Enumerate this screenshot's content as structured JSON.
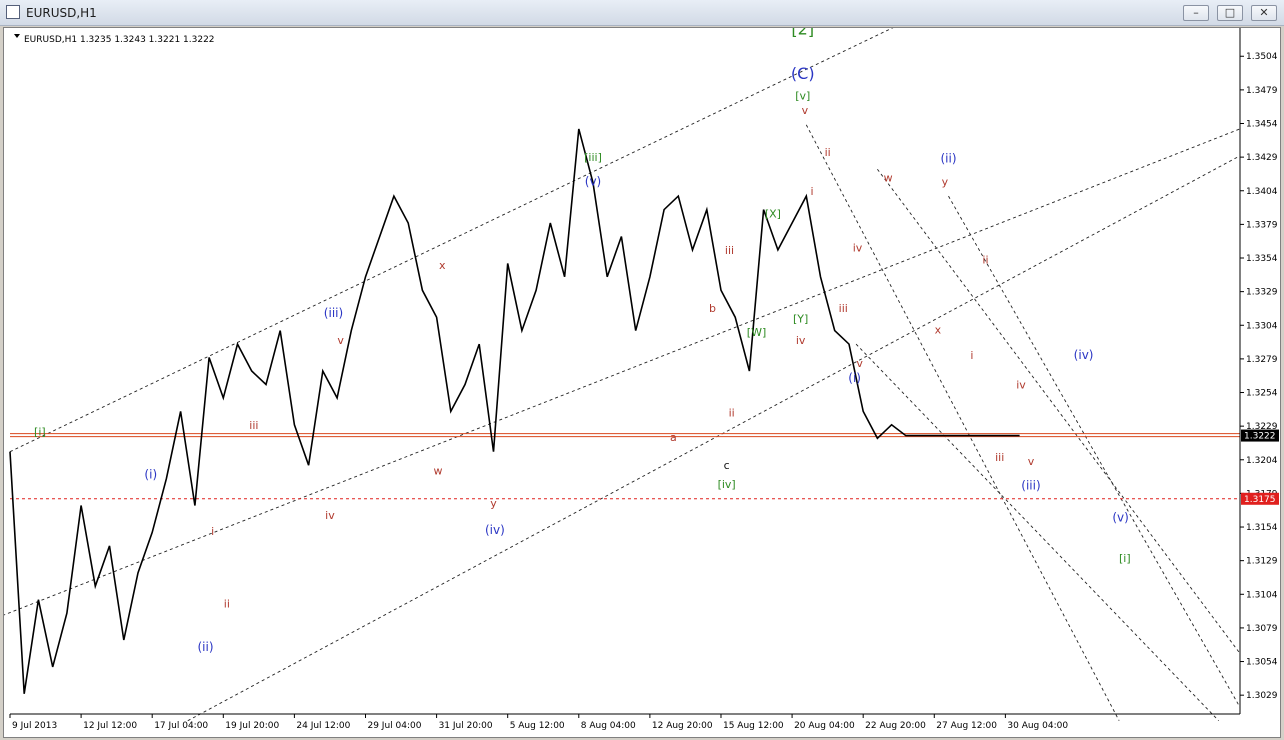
{
  "window": {
    "title": "EURUSD,H1",
    "buttons": {
      "minimize": "–",
      "maximize": "□",
      "close": "✕"
    }
  },
  "chart_data": {
    "type": "line",
    "header": "EURUSD,H1  1.3235 1.3243 1.3221 1.3222",
    "ylim": [
      1.3015,
      1.3525
    ],
    "y_ticks": [
      1.3504,
      1.3479,
      1.3454,
      1.3429,
      1.3404,
      1.3379,
      1.3354,
      1.3329,
      1.3304,
      1.3279,
      1.3254,
      1.3229,
      1.3204,
      1.3179,
      1.3154,
      1.3129,
      1.3104,
      1.3079,
      1.3054,
      1.3029
    ],
    "x_ticks": [
      "9 Jul 2013",
      "12 Jul 12:00",
      "17 Jul 04:00",
      "19 Jul 20:00",
      "24 Jul 12:00",
      "29 Jul 04:00",
      "31 Jul 20:00",
      "5 Aug 12:00",
      "8 Aug 04:00",
      "12 Aug 20:00",
      "15 Aug 12:00",
      "20 Aug 04:00",
      "22 Aug 20:00",
      "27 Aug 12:00",
      "30 Aug 04:00"
    ],
    "x_tick_index": [
      0,
      1,
      2,
      3,
      4,
      5,
      6,
      7,
      8,
      9,
      10,
      11,
      12,
      13,
      14
    ],
    "current_price": {
      "value": 1.3222,
      "label": "1.3222",
      "color": "#d9481f"
    },
    "level_line": {
      "value": 1.3175,
      "label": "1.3175",
      "color": "#e0201e"
    },
    "series": [
      {
        "color": "#000000",
        "x": [
          0,
          0.2,
          0.4,
          0.6,
          0.8,
          1.0,
          1.2,
          1.4,
          1.6,
          1.8,
          2.0,
          2.2,
          2.4,
          2.6,
          2.8,
          3.0,
          3.2,
          3.4,
          3.6,
          3.8,
          4.0,
          4.2,
          4.4,
          4.6,
          4.8,
          5.0,
          5.2,
          5.4,
          5.6,
          5.8,
          6.0,
          6.2,
          6.4,
          6.6,
          6.8,
          7.0,
          7.2,
          7.4,
          7.6,
          7.8,
          8.0,
          8.2,
          8.4,
          8.6,
          8.8,
          9.0,
          9.2,
          9.4,
          9.6,
          9.8,
          10.0,
          10.2,
          10.4,
          10.6,
          10.8,
          11.0,
          11.2,
          11.4,
          11.6,
          11.8,
          12.0,
          12.2,
          12.4,
          12.6,
          12.8,
          13.0,
          13.2,
          13.4,
          13.6,
          13.8,
          14.0,
          14.2
        ],
        "y": [
          1.321,
          1.303,
          1.31,
          1.305,
          1.309,
          1.317,
          1.311,
          1.314,
          1.307,
          1.312,
          1.315,
          1.319,
          1.324,
          1.317,
          1.328,
          1.325,
          1.329,
          1.327,
          1.326,
          1.33,
          1.323,
          1.32,
          1.327,
          1.325,
          1.33,
          1.334,
          1.337,
          1.34,
          1.338,
          1.333,
          1.331,
          1.324,
          1.326,
          1.329,
          1.321,
          1.335,
          1.33,
          1.333,
          1.338,
          1.334,
          1.345,
          1.341,
          1.334,
          1.337,
          1.33,
          1.334,
          1.339,
          1.34,
          1.336,
          1.339,
          1.333,
          1.331,
          1.327,
          1.339,
          1.336,
          1.338,
          1.34,
          1.334,
          1.33,
          1.329,
          1.324,
          1.322,
          1.323,
          1.3222,
          1.3222,
          1.3222,
          1.3222,
          1.3222,
          1.3222,
          1.3222,
          1.3222,
          1.3222
        ]
      }
    ],
    "annotations": [
      {
        "text": "[2]",
        "x": 11.15,
        "y": 1.352,
        "color": "#2e8b22",
        "size": 16
      },
      {
        "text": "(C)",
        "x": 11.15,
        "y": 1.3487,
        "color": "#2a35c4",
        "size": 16
      },
      {
        "text": "[v]",
        "x": 11.15,
        "y": 1.3472,
        "color": "#2e8b22",
        "size": 11
      },
      {
        "text": "v",
        "x": 11.18,
        "y": 1.3461,
        "color": "#b03a2e",
        "size": 11
      },
      {
        "text": "ii",
        "x": 11.5,
        "y": 1.343,
        "color": "#b03a2e",
        "size": 11
      },
      {
        "text": "i",
        "x": 11.28,
        "y": 1.3401,
        "color": "#b03a2e",
        "size": 11
      },
      {
        "text": "[X]",
        "x": 10.73,
        "y": 1.3384,
        "color": "#2e8b22",
        "size": 11
      },
      {
        "text": "iii",
        "x": 10.12,
        "y": 1.3357,
        "color": "#b03a2e",
        "size": 11
      },
      {
        "text": "iv",
        "x": 11.92,
        "y": 1.3359,
        "color": "#b03a2e",
        "size": 11
      },
      {
        "text": "iii",
        "x": 11.72,
        "y": 1.3314,
        "color": "#b03a2e",
        "size": 11
      },
      {
        "text": "[Y]",
        "x": 11.12,
        "y": 1.3306,
        "color": "#2e8b22",
        "size": 11
      },
      {
        "text": "[W]",
        "x": 10.5,
        "y": 1.3296,
        "color": "#2e8b22",
        "size": 11
      },
      {
        "text": "iv",
        "x": 11.12,
        "y": 1.329,
        "color": "#b03a2e",
        "size": 11
      },
      {
        "text": "v",
        "x": 11.95,
        "y": 1.3273,
        "color": "#b03a2e",
        "size": 11
      },
      {
        "text": "(i)",
        "x": 11.88,
        "y": 1.3262,
        "color": "#2a35c4",
        "size": 12
      },
      {
        "text": "[iii]",
        "x": 8.2,
        "y": 1.3426,
        "color": "#2e8b22",
        "size": 11
      },
      {
        "text": "(v)",
        "x": 8.2,
        "y": 1.3408,
        "color": "#2a35c4",
        "size": 12
      },
      {
        "text": "b",
        "x": 9.88,
        "y": 1.3314,
        "color": "#b03a2e",
        "size": 11
      },
      {
        "text": "ii",
        "x": 10.15,
        "y": 1.3236,
        "color": "#b03a2e",
        "size": 11
      },
      {
        "text": "a",
        "x": 9.33,
        "y": 1.3218,
        "color": "#b03a2e",
        "size": 11
      },
      {
        "text": "c",
        "x": 10.08,
        "y": 1.3197,
        "color": "#111111",
        "size": 11
      },
      {
        "text": "[iv]",
        "x": 10.08,
        "y": 1.3183,
        "color": "#2e8b22",
        "size": 11
      },
      {
        "text": "w",
        "x": 12.35,
        "y": 1.3411,
        "color": "#b03a2e",
        "size": 11
      },
      {
        "text": "(ii)",
        "x": 13.2,
        "y": 1.3425,
        "color": "#2a35c4",
        "size": 12
      },
      {
        "text": "y",
        "x": 13.15,
        "y": 1.3408,
        "color": "#b03a2e",
        "size": 11
      },
      {
        "text": "ii",
        "x": 13.72,
        "y": 1.335,
        "color": "#b03a2e",
        "size": 11
      },
      {
        "text": "x",
        "x": 13.05,
        "y": 1.3298,
        "color": "#b03a2e",
        "size": 11
      },
      {
        "text": "i",
        "x": 13.53,
        "y": 1.3279,
        "color": "#b03a2e",
        "size": 11
      },
      {
        "text": "(iv)",
        "x": 15.1,
        "y": 1.3279,
        "color": "#2a35c4",
        "size": 12
      },
      {
        "text": "iv",
        "x": 14.22,
        "y": 1.3257,
        "color": "#b03a2e",
        "size": 11
      },
      {
        "text": "iii",
        "x": 13.92,
        "y": 1.3203,
        "color": "#b03a2e",
        "size": 11
      },
      {
        "text": "v",
        "x": 14.36,
        "y": 1.32,
        "color": "#b03a2e",
        "size": 11
      },
      {
        "text": "(iii)",
        "x": 14.36,
        "y": 1.3182,
        "color": "#2a35c4",
        "size": 12
      },
      {
        "text": "(v)",
        "x": 15.62,
        "y": 1.3158,
        "color": "#2a35c4",
        "size": 12
      },
      {
        "text": "[i]",
        "x": 15.68,
        "y": 1.3128,
        "color": "#2e8b22",
        "size": 11
      },
      {
        "text": "[i]",
        "x": 0.42,
        "y": 1.3222,
        "color": "#2e8b22",
        "size": 11
      },
      {
        "text": "(i)",
        "x": 1.98,
        "y": 1.319,
        "color": "#2a35c4",
        "size": 12
      },
      {
        "text": "i",
        "x": 2.85,
        "y": 1.3148,
        "color": "#b03a2e",
        "size": 11
      },
      {
        "text": "ii",
        "x": 3.05,
        "y": 1.3094,
        "color": "#b03a2e",
        "size": 11
      },
      {
        "text": "(ii)",
        "x": 2.75,
        "y": 1.3062,
        "color": "#2a35c4",
        "size": 12
      },
      {
        "text": "iii",
        "x": 3.43,
        "y": 1.3227,
        "color": "#b03a2e",
        "size": 11
      },
      {
        "text": "(iii)",
        "x": 4.55,
        "y": 1.331,
        "color": "#2a35c4",
        "size": 12
      },
      {
        "text": "v",
        "x": 4.65,
        "y": 1.329,
        "color": "#b03a2e",
        "size": 11
      },
      {
        "text": "iv",
        "x": 4.5,
        "y": 1.316,
        "color": "#b03a2e",
        "size": 11
      },
      {
        "text": "x",
        "x": 6.08,
        "y": 1.3346,
        "color": "#b03a2e",
        "size": 11
      },
      {
        "text": "w",
        "x": 6.02,
        "y": 1.3193,
        "color": "#b03a2e",
        "size": 11
      },
      {
        "text": "y",
        "x": 6.8,
        "y": 1.3169,
        "color": "#b03a2e",
        "size": 11
      },
      {
        "text": "(iv)",
        "x": 6.82,
        "y": 1.3149,
        "color": "#2a35c4",
        "size": 12
      }
    ]
  }
}
